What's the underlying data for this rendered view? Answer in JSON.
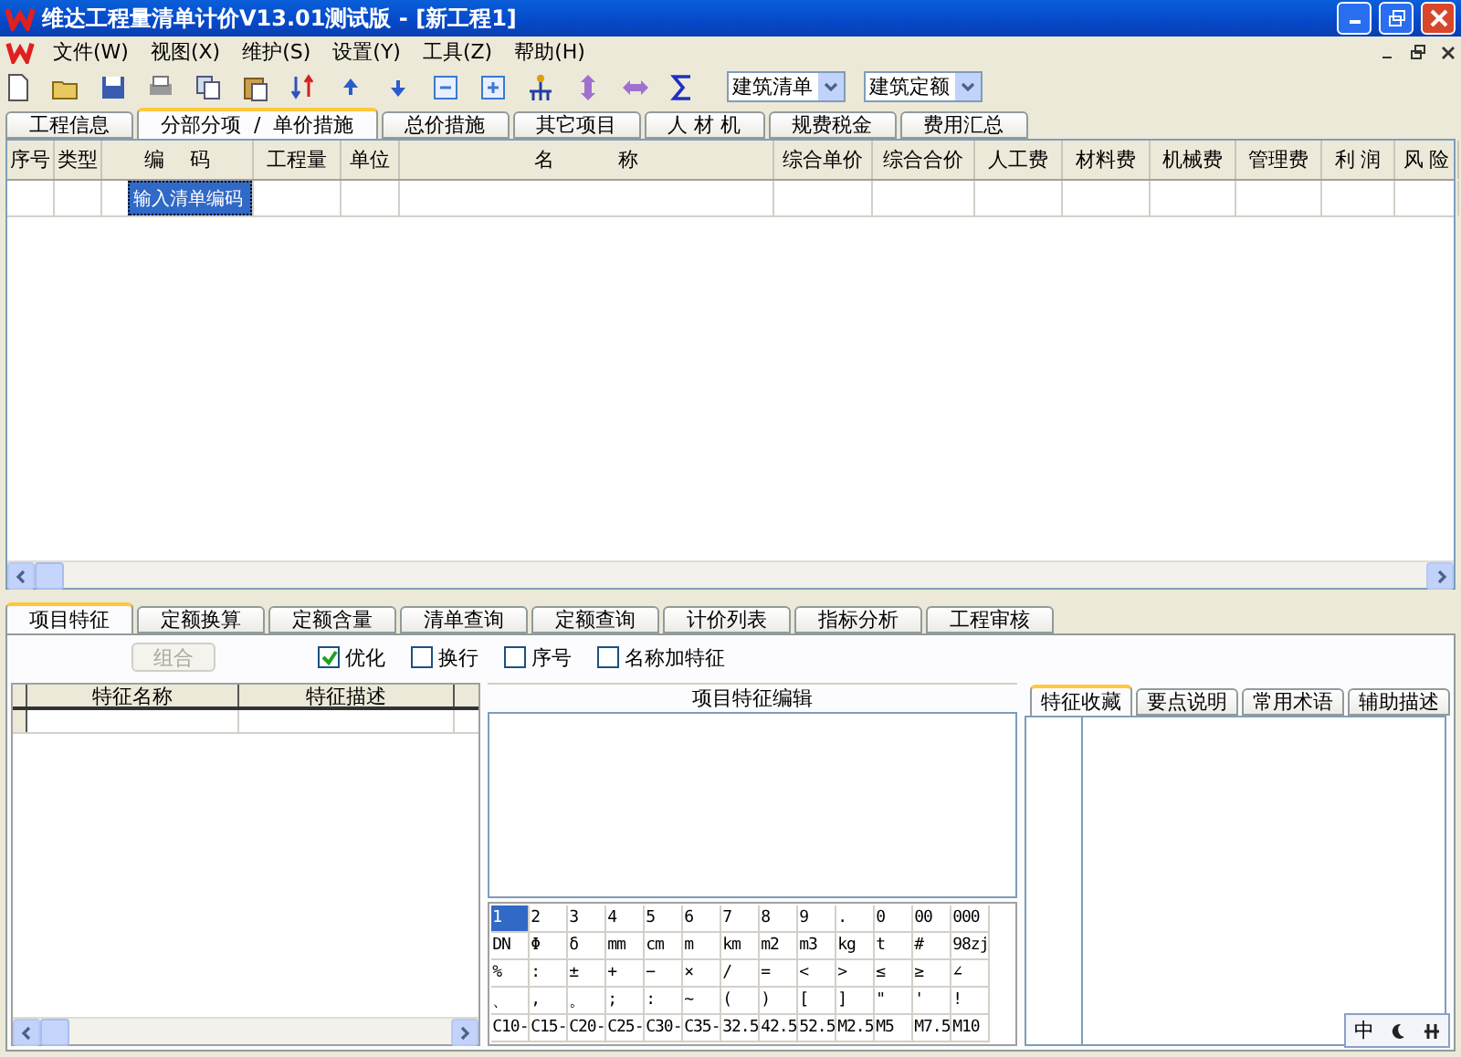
{
  "window": {
    "title": "维达工程量清单计价V13.01测试版 - [新工程1]"
  },
  "menu": [
    "文件(W)",
    "视图(X)",
    "维护(S)",
    "设置(Y)",
    "工具(Z)",
    "帮助(H)"
  ],
  "toolbar": {
    "dropdowns": [
      {
        "value": "建筑清单"
      },
      {
        "value": "建筑定额"
      }
    ]
  },
  "tabs": [
    {
      "label": "工程信息",
      "selected": false
    },
    {
      "label": "分部分项  /  单价措施",
      "selected": true
    },
    {
      "label": "总价措施",
      "selected": false
    },
    {
      "label": "其它项目",
      "selected": false
    },
    {
      "label": "人 材 机",
      "selected": false
    },
    {
      "label": "规费税金",
      "selected": false
    },
    {
      "label": "费用汇总",
      "selected": false
    }
  ],
  "table": {
    "columns": [
      "序号",
      "类型",
      "编    码",
      "工程量",
      "单位",
      "名          称",
      "综合单价",
      "综合合价",
      "人工费",
      "材料费",
      "机械费",
      "管理费",
      "利 润",
      "风 险"
    ],
    "rows": [
      {
        "code": "输入清单编码",
        "focused": true
      }
    ]
  },
  "bottom_tabs": [
    {
      "label": "项目特征",
      "selected": true
    },
    {
      "label": "定额换算",
      "selected": false
    },
    {
      "label": "定额含量",
      "selected": false
    },
    {
      "label": "清单查询",
      "selected": false
    },
    {
      "label": "定额查询",
      "selected": false
    },
    {
      "label": "计价列表",
      "selected": false
    },
    {
      "label": "指标分析",
      "selected": false
    },
    {
      "label": "工程审核",
      "selected": false
    }
  ],
  "options": {
    "button": {
      "label": "组合",
      "disabled": true
    },
    "checkboxes": [
      {
        "label": "优化",
        "checked": true
      },
      {
        "label": "换行",
        "checked": false
      },
      {
        "label": "序号",
        "checked": false
      },
      {
        "label": "名称加特征",
        "checked": false
      }
    ]
  },
  "feature_table": {
    "columns": [
      "特征名称",
      "特征描述"
    ]
  },
  "editor": {
    "title": "项目特征编辑"
  },
  "symbols": [
    [
      {
        "text": "1",
        "selected": true
      },
      {
        "text": "2",
        "selected": false
      },
      {
        "text": "3",
        "selected": false
      },
      {
        "text": "4",
        "selected": false
      },
      {
        "text": "5",
        "selected": false
      },
      {
        "text": "6",
        "selected": false
      },
      {
        "text": "7",
        "selected": false
      },
      {
        "text": "8",
        "selected": false
      },
      {
        "text": "9",
        "selected": false
      },
      {
        "text": ".",
        "selected": false
      },
      {
        "text": "0",
        "selected": false
      },
      {
        "text": "00",
        "selected": false
      },
      {
        "text": "000",
        "selected": false
      }
    ],
    [
      {
        "text": "DN",
        "selected": false
      },
      {
        "text": "Φ",
        "selected": false
      },
      {
        "text": "δ",
        "selected": false
      },
      {
        "text": "mm",
        "selected": false
      },
      {
        "text": "cm",
        "selected": false
      },
      {
        "text": "m",
        "selected": false
      },
      {
        "text": "km",
        "selected": false
      },
      {
        "text": "m2",
        "selected": false
      },
      {
        "text": "m3",
        "selected": false
      },
      {
        "text": "kg",
        "selected": false
      },
      {
        "text": "t",
        "selected": false
      },
      {
        "text": "#",
        "selected": false
      },
      {
        "text": "98zj",
        "selected": false
      }
    ],
    [
      {
        "text": "%",
        "selected": false
      },
      {
        "text": ":",
        "selected": false
      },
      {
        "text": "±",
        "selected": false
      },
      {
        "text": "+",
        "selected": false
      },
      {
        "text": "−",
        "selected": false
      },
      {
        "text": "×",
        "selected": false
      },
      {
        "text": "/",
        "selected": false
      },
      {
        "text": "=",
        "selected": false
      },
      {
        "text": "<",
        "selected": false
      },
      {
        "text": ">",
        "selected": false
      },
      {
        "text": "≤",
        "selected": false
      },
      {
        "text": "≥",
        "selected": false
      },
      {
        "text": "∠",
        "selected": false
      }
    ],
    [
      {
        "text": "、",
        "selected": false
      },
      {
        "text": ",",
        "selected": false
      },
      {
        "text": "。",
        "selected": false
      },
      {
        "text": ";",
        "selected": false
      },
      {
        "text": ":",
        "selected": false
      },
      {
        "text": "~",
        "selected": false
      },
      {
        "text": "(",
        "selected": false
      },
      {
        "text": ")",
        "selected": false
      },
      {
        "text": "[",
        "selected": false
      },
      {
        "text": "]",
        "selected": false
      },
      {
        "text": "\"",
        "selected": false
      },
      {
        "text": "'",
        "selected": false
      },
      {
        "text": "!",
        "selected": false
      }
    ],
    [
      {
        "text": "C10-",
        "selected": false
      },
      {
        "text": "C15-",
        "selected": false
      },
      {
        "text": "C20-",
        "selected": false
      },
      {
        "text": "C25-",
        "selected": false
      },
      {
        "text": "C30-",
        "selected": false
      },
      {
        "text": "C35-",
        "selected": false
      },
      {
        "text": "32.5",
        "selected": false
      },
      {
        "text": "42.5",
        "selected": false
      },
      {
        "text": "52.5",
        "selected": false
      },
      {
        "text": "M2.5",
        "selected": false
      },
      {
        "text": "M5",
        "selected": false
      },
      {
        "text": "M7.5",
        "selected": false
      },
      {
        "text": "M10",
        "selected": false
      }
    ]
  ],
  "side_tabs": [
    {
      "label": "特征收藏",
      "selected": true
    },
    {
      "label": "要点说明",
      "selected": false
    },
    {
      "label": "常用术语",
      "selected": false
    },
    {
      "label": "辅助描述",
      "selected": false
    }
  ],
  "ime": {
    "mode": "中"
  }
}
